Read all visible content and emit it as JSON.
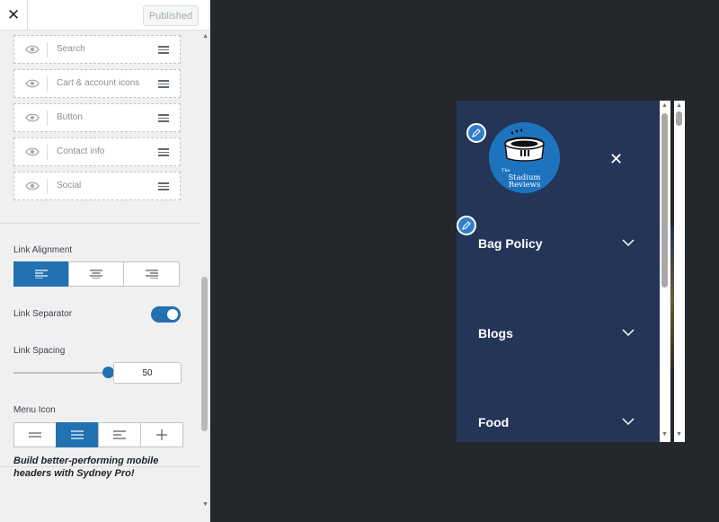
{
  "header": {
    "close_icon": "close-icon",
    "publish_label": "Published"
  },
  "components": [
    {
      "label": "Search"
    },
    {
      "label": "Cart & account icons"
    },
    {
      "label": "Button"
    },
    {
      "label": "Contact info"
    },
    {
      "label": "Social"
    }
  ],
  "settings": {
    "link_alignment_label": "Link Alignment",
    "link_alignment_selected": "left",
    "link_separator_label": "Link Separator",
    "link_separator_enabled": true,
    "link_spacing_label": "Link Spacing",
    "link_spacing_value": "50",
    "menu_icon_label": "Menu Icon",
    "menu_icon_selected": 2
  },
  "promo": {
    "text": "Build better-performing mobile headers with Sydney Pro!"
  },
  "preview": {
    "logo_text_line1": "The",
    "logo_text_line2": "Stadium",
    "logo_text_line3": "Reviews",
    "menu": [
      {
        "label": "Bag Policy"
      },
      {
        "label": "Blogs"
      },
      {
        "label": "Food"
      }
    ]
  },
  "colors": {
    "accent": "#2271b1",
    "preview_bg": "#243558",
    "logo_bg": "#1e73be",
    "outer_bg": "#23282d"
  }
}
